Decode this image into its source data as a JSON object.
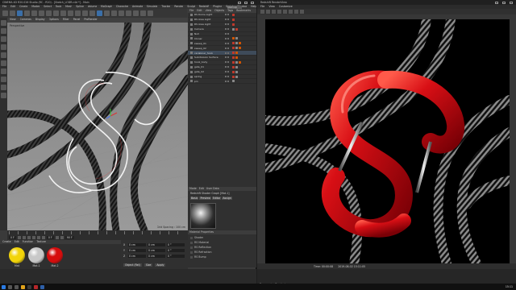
{
  "c4d": {
    "title": "CINEMA 4D R20.026 Studio (RC - R20) - [Sketch_LODR.c4d *] - Main",
    "menu": [
      "File",
      "Edit",
      "Create",
      "Modes",
      "Select",
      "Tools",
      "Mesh",
      "Spline",
      "Volume",
      "MoGraph",
      "Character",
      "Animate",
      "Simulate",
      "Tracker",
      "Render",
      "Sculpt",
      "Motion Tracker",
      "Redshift",
      "Plugins",
      "Script",
      "Window",
      "Help"
    ],
    "layout_label": "Startup",
    "viewport": {
      "menu": [
        "View",
        "Cameras",
        "Display",
        "Options",
        "Filter",
        "Panel",
        "ProRender"
      ],
      "label": "Perspective",
      "grid_spacing": "Grid Spacing : 100 cm"
    },
    "object_manager": {
      "tabs": [
        "File",
        "Edit",
        "View",
        "Objects",
        "Tags",
        "Bookmarks"
      ],
      "rows": [
        {
          "name": "RS Dome Light",
          "tags": [
            "#c0392b"
          ]
        },
        {
          "name": "RS Area Light",
          "tags": [
            "#c0392b"
          ]
        },
        {
          "name": "RS Area Light",
          "tags": [
            "#c0392b"
          ]
        },
        {
          "name": "Camera",
          "tags": [
            "#888888",
            "#c0392b"
          ]
        },
        {
          "name": "Null",
          "tags": []
        },
        {
          "name": "Cloner",
          "tags": [
            "#d35400",
            "#888888"
          ]
        },
        {
          "name": "sweep_01",
          "tags": [
            "#c0392b",
            "#888888",
            "#d35400"
          ]
        },
        {
          "name": "sweep_02",
          "tags": [
            "#c0392b",
            "#888888",
            "#d35400"
          ]
        },
        {
          "name": "carabiner_hook",
          "tags": [
            "#c0392b",
            "#d35400"
          ]
        },
        {
          "name": "Subdivision Surface",
          "tags": [
            "#c0392b",
            "#d35400"
          ]
        },
        {
          "name": "hook_body",
          "tags": [
            "#c0392b",
            "#888888",
            "#d35400"
          ]
        },
        {
          "name": "gate_01",
          "tags": [
            "#c0392b",
            "#888888"
          ]
        },
        {
          "name": "gate_02",
          "tags": [
            "#c0392b",
            "#888888"
          ]
        },
        {
          "name": "spring",
          "tags": [
            "#c0392b",
            "#888888"
          ]
        },
        {
          "name": "pin",
          "tags": [
            "#888888"
          ]
        }
      ]
    },
    "attribute_manager": {
      "tabs": [
        "Mode",
        "Edit",
        "User Data"
      ],
      "title": "Redshift Shader Graph [Mat.1]",
      "buttons": [
        "Basic",
        "Preview",
        "Editor",
        "Assign"
      ],
      "section": "Material Properties",
      "rows": [
        "Shader",
        "RS Material",
        "RS Reflection",
        "RS Refraction",
        "RS Bump"
      ]
    },
    "timeline": {
      "start_frame": "0 F",
      "current_frame": "0 F",
      "end_frame": "90 F"
    },
    "material_manager": {
      "menu": [
        "Create",
        "Edit",
        "Function",
        "Texture"
      ],
      "materials": [
        {
          "label": "Mat",
          "color": "#f2d40a"
        },
        {
          "label": "Mat.1",
          "color": "#c8c8c8"
        },
        {
          "label": "Mat.2",
          "color": "#d60d0d"
        }
      ]
    },
    "coordinates": {
      "rows": [
        {
          "axis": "X",
          "pos": "0 cm",
          "size": "0 cm",
          "rot": "0 °"
        },
        {
          "axis": "Y",
          "pos": "0 cm",
          "size": "0 cm",
          "rot": "0 °"
        },
        {
          "axis": "Z",
          "pos": "0 cm",
          "size": "0 cm",
          "rot": "0 °"
        }
      ],
      "mode": "Object (Rel)",
      "size_mode": "Size",
      "apply": "Apply"
    }
  },
  "redshift": {
    "title": "Redshift RenderView",
    "menu": [
      "File",
      "View",
      "Customize"
    ],
    "bottom_info": "Time: 00:00:08",
    "bottom_date": "2019-08-02 15:11:05",
    "status": "Progressive Rendering..."
  },
  "taskbar": {
    "clock": "15:11"
  },
  "colors": {
    "hook_red": "#cc0a12",
    "viewport_bg": "#8c8c8c",
    "render_bg": "#000000"
  }
}
